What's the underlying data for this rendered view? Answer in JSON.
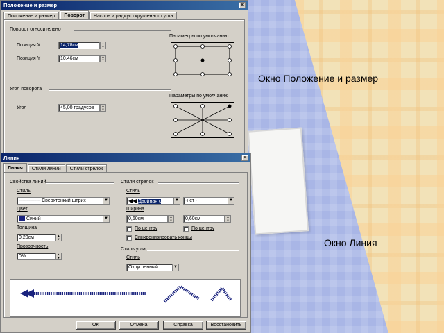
{
  "captions": {
    "position_window": "Окно Положение и размер",
    "line_window": "Окно Линия"
  },
  "position_dialog": {
    "title": "Положение и размер",
    "tabs": [
      "Положение и размер",
      "Поворот",
      "Наклон и радиус скругленного угла"
    ],
    "active_tab": "Поворот",
    "rotation_group": "Поворот относительно",
    "position_x_label": "Позиция X",
    "position_x_value": "14,78см",
    "position_y_label": "Позиция Y",
    "position_y_value": "10,46см",
    "defaults_label_1": "Параметры по умолчанию",
    "angle_group": "Угол поворота",
    "angle_label": "Угол",
    "angle_value": "45,00 градусов",
    "defaults_label_2": "Параметры по умолчанию"
  },
  "line_dialog": {
    "title": "Линия",
    "tabs": [
      "Линия",
      "Стили линии",
      "Стили стрелок"
    ],
    "active_tab": "Линия",
    "line_props_group": "Свойства линий",
    "style_label": "Стиль",
    "style_value": "Сверхтонкий штрих",
    "color_label": "Цвет",
    "color_value": "Синий",
    "width_label": "Толщина",
    "width_value": "0,20см",
    "transparency_label": "Прозрачность",
    "transparency_value": "0%",
    "arrow_group": "Стили стрелок",
    "arrow_style_label": "Стиль",
    "arrow_start_value": "Двойная с",
    "arrow_end_value": "-нет -",
    "arrow_width_label": "Ширина",
    "arrow_width_start": "0,60см",
    "arrow_width_end": "0,60см",
    "center_label_1": "По центру",
    "center_label_2": "По центру",
    "sync_label": "Синхронизировать концы",
    "corner_group": "Стиль угла",
    "corner_style_label": "Стиль",
    "corner_style_value": "Округленный",
    "buttons": {
      "ok": "OK",
      "cancel": "Отмена",
      "help": "Справка",
      "reset": "Восстановить"
    }
  },
  "colors": {
    "titlebar": "#0a246a",
    "dialog_bg": "#d4d0c8",
    "selection": "#0a246a",
    "line_color": "#1a237e"
  }
}
